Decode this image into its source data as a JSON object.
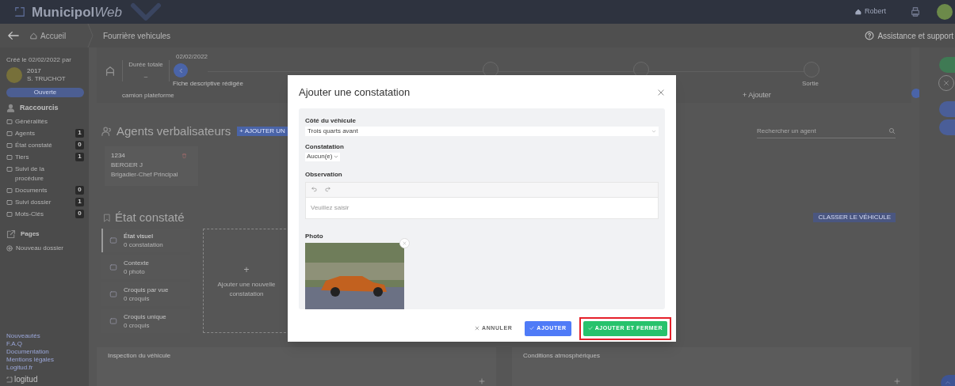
{
  "header": {
    "logo_main": "Municipol",
    "logo_accent": "Web",
    "user": "Robert"
  },
  "breadcrumb": {
    "home": "Accueil",
    "current": "Fourrière vehicules",
    "help": "Assistance et support"
  },
  "sidebar": {
    "created": "Créé le 02/02/2022 par",
    "user_id": "2017",
    "user_name": "S. TRUCHOT",
    "status": "Ouverte",
    "shortcuts_title": "Raccourcis",
    "shortcuts": [
      {
        "label": "Généralités"
      },
      {
        "label": "Agents",
        "count": "1"
      },
      {
        "label": "État constaté",
        "count": "0"
      },
      {
        "label": "Tiers",
        "count": "1"
      },
      {
        "label": "Suivi de la procédure"
      },
      {
        "label": "Documents",
        "count": "0"
      },
      {
        "label": "Suivi dossier",
        "count": "1"
      },
      {
        "label": "Mots-Clés",
        "count": "0"
      }
    ],
    "pages_title": "Pages",
    "new_folder": "Nouveau dossier",
    "links": [
      "Nouveautés",
      "F.A.Q",
      "Documentation",
      "Mentions légales",
      "Logitud.fr"
    ],
    "brand": "logitud"
  },
  "progress": {
    "duration_label": "Durée totale",
    "duration": "–",
    "date": "02/02/2022",
    "first_step": "Fiche descriptive rédigée",
    "last_step": "Sortie",
    "vehicle_type": "camion plateforme",
    "add_link": "+ Ajouter"
  },
  "agents": {
    "title": "Agents verbalisateurs",
    "add_button": "+ AJOUTER UN",
    "search_placeholder": "Rechercher un agent",
    "items": [
      {
        "id": "1234",
        "name": "BERGER J",
        "rank": "Brigadier-Chef Principal"
      }
    ]
  },
  "state": {
    "title": "État constaté",
    "tabs": [
      {
        "title": "État visuel",
        "subtitle": "0 constatation",
        "selected": true
      },
      {
        "title": "Contexte",
        "subtitle": "0 photo",
        "selected": false
      },
      {
        "title": "Croquis par vue",
        "subtitle": "0 croquis",
        "selected": false
      },
      {
        "title": "Croquis unique",
        "subtitle": "0 croquis",
        "selected": false
      }
    ],
    "add_tile": {
      "icon_text": "+",
      "label": "Ajouter une nouvelle constatation"
    },
    "classify_button": "CLASSER LE VÉHICULE"
  },
  "panels": [
    {
      "title": "Inspection du véhicule"
    },
    {
      "title": "Conditions atmosphériques"
    }
  ],
  "modal": {
    "title": "Ajouter une constatation",
    "side_field": {
      "label": "Côté du véhicule",
      "value": "Trois quarts avant"
    },
    "finding_field": {
      "label": "Constatation",
      "value": "Aucun(e)"
    },
    "observation": {
      "label": "Observation",
      "placeholder": "Veuillez saisir"
    },
    "photo_label": "Photo",
    "buttons": [
      {
        "kind": "text",
        "label": "ANNULER",
        "highlighted": false
      },
      {
        "kind": "primary",
        "label": "AJOUTER",
        "highlighted": false
      },
      {
        "kind": "success",
        "label": "AJOUTER ET FERMER",
        "highlighted": true
      }
    ]
  }
}
